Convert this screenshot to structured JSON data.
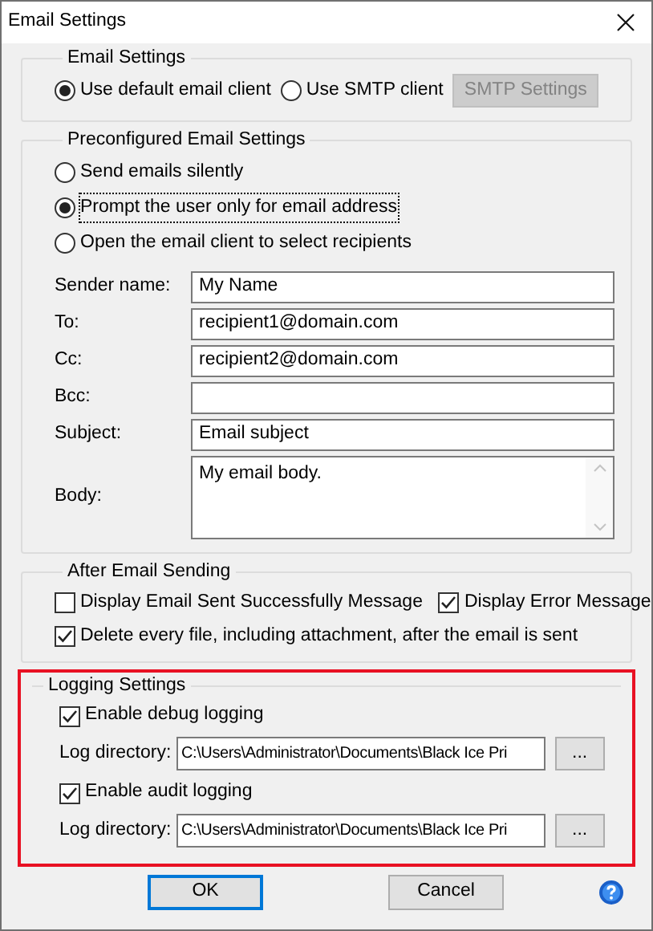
{
  "window": {
    "title": "Email Settings"
  },
  "email_settings": {
    "title": "Email Settings",
    "options": [
      {
        "label": "Use default email client",
        "selected": true
      },
      {
        "label": "Use SMTP client",
        "selected": false
      }
    ],
    "smtp_button": {
      "label": "SMTP Settings",
      "disabled": true
    }
  },
  "preconfigured": {
    "title": "Preconfigured Email Settings",
    "options": [
      {
        "label": "Send emails silently",
        "selected": false,
        "focused": false
      },
      {
        "label": "Prompt the user only for email address",
        "selected": true,
        "focused": true
      },
      {
        "label": "Open the email client to select recipients",
        "selected": false,
        "focused": false
      }
    ],
    "fields": [
      {
        "label": "Sender name:",
        "value": "My Name",
        "kind": "text"
      },
      {
        "label": "To:",
        "value": "recipient1@domain.com",
        "kind": "text"
      },
      {
        "label": "Cc:",
        "value": "recipient2@domain.com",
        "kind": "text"
      },
      {
        "label": "Bcc:",
        "kind": "text"
      },
      {
        "label": "Subject:",
        "value": "Email subject",
        "kind": "text"
      },
      {
        "label": "Body:",
        "value": "My email body.",
        "kind": "multiline"
      }
    ]
  },
  "after_sending": {
    "title": "After Email Sending",
    "rows": [
      [
        {
          "label": "Display Email Sent Successfully Message",
          "checked": false
        },
        {
          "label": "Display Error Message",
          "checked": true
        }
      ],
      [
        {
          "label": "Delete every file, including attachment, after the email is sent",
          "checked": true
        }
      ]
    ]
  },
  "logging": {
    "title": "Logging Settings",
    "highlighted": true,
    "entries": [
      {
        "checkbox": {
          "label": "Enable debug logging",
          "checked": true
        },
        "dir_label": "Log directory:",
        "dir_value": "C:\\Users\\Administrator\\Documents\\Black Ice Pri",
        "browse": "..."
      },
      {
        "checkbox": {
          "label": "Enable audit logging",
          "checked": true
        },
        "dir_label": "Log directory:",
        "dir_value": "C:\\Users\\Administrator\\Documents\\Black Ice Pri",
        "browse": "..."
      }
    ]
  },
  "buttons": [
    {
      "label": "OK",
      "default": true
    },
    {
      "label": "Cancel",
      "default": false
    }
  ]
}
